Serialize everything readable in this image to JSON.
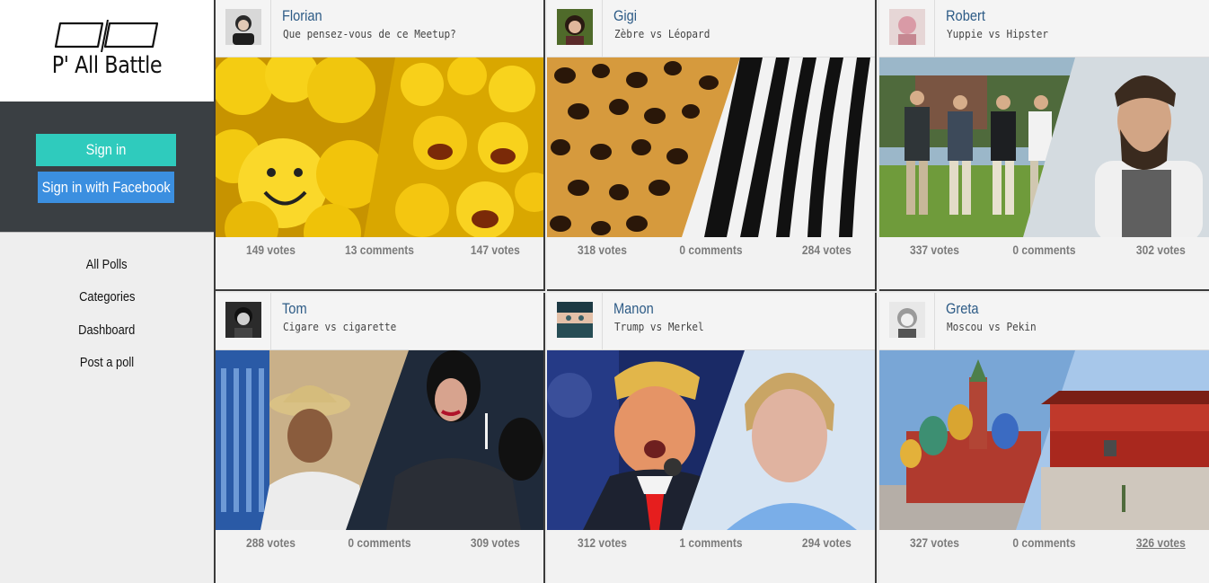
{
  "brand": {
    "title": "P' All Battle"
  },
  "auth": {
    "signin_label": "Sign in",
    "facebook_label": "Sign in with Facebook"
  },
  "nav": {
    "items": [
      {
        "label": "All Polls"
      },
      {
        "label": "Categories"
      },
      {
        "label": "Dashboard"
      },
      {
        "label": "Post a poll"
      }
    ]
  },
  "polls": [
    {
      "user": "Florian",
      "title": "Que pensez-vous de ce Meetup?",
      "left_votes": "149 votes",
      "comments": "13 comments",
      "right_votes": "147 votes",
      "left_image": "smiley-faces",
      "right_image": "laughing-faces"
    },
    {
      "user": "Gigi",
      "title": "Zèbre vs Léopard",
      "left_votes": "318 votes",
      "comments": "0 comments",
      "right_votes": "284 votes",
      "left_image": "leopard-print",
      "right_image": "zebra-stripes"
    },
    {
      "user": "Robert",
      "title": "Yuppie vs Hipster",
      "left_votes": "337 votes",
      "comments": "0 comments",
      "right_votes": "302 votes",
      "left_image": "yuppies-group",
      "right_image": "bearded-hipster"
    },
    {
      "user": "Tom",
      "title": "Cigare vs cigarette",
      "left_votes": "288 votes",
      "comments": "0 comments",
      "right_votes": "309 votes",
      "left_image": "cigar-smoker",
      "right_image": "cigarette-woman"
    },
    {
      "user": "Manon",
      "title": "Trump vs Merkel",
      "left_votes": "312 votes",
      "comments": "1 comments",
      "right_votes": "294 votes",
      "left_image": "trump-portrait",
      "right_image": "merkel-portrait"
    },
    {
      "user": "Greta",
      "title": "Moscou vs Pekin",
      "left_votes": "327 votes",
      "comments": "0 comments",
      "right_votes": "326 votes",
      "left_image": "saint-basil-cathedral",
      "right_image": "tiananmen-gate"
    }
  ],
  "colors": {
    "accent": "#2fcbbd",
    "facebook": "#3b8fe0",
    "username": "#2d5b86",
    "dark": "#3a3f43"
  }
}
